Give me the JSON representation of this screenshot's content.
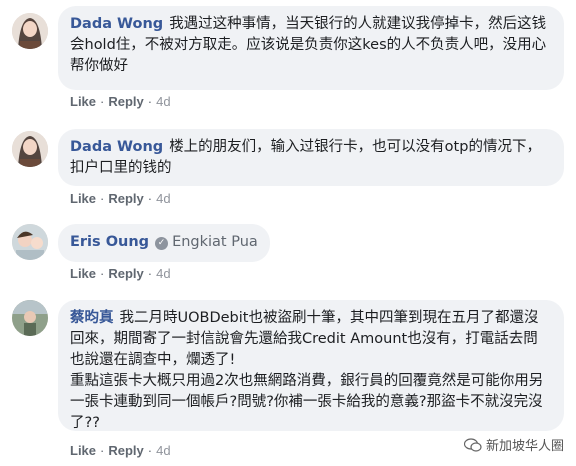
{
  "comments": [
    {
      "author": "Dada Wong",
      "text": "我遇过这种事情，当天银行的人就建议我停掉卡，然后这钱会hold住，不被对方取走。应该说是负责你这kes的人不负责人吧，没用心帮你做好",
      "like": "Like",
      "reply": "Reply",
      "time": "4d"
    },
    {
      "author": "Dada Wong",
      "text": "楼上的朋友们，输入过银行卡，也可以没有otp的情况下，扣户口里的钱的",
      "like": "Like",
      "reply": "Reply",
      "time": "4d"
    },
    {
      "author": "Eris Oung",
      "tagged": "Engkiat Pua",
      "like": "Like",
      "reply": "Reply",
      "time": "4d"
    },
    {
      "author": "蔡昀真",
      "text": "我二月時UOBDebit也被盜刷十筆，其中四筆到現在五月了都還沒回來，期間寄了一封信說會先還給我Credit Amount也沒有，打電話去問也說還在調查中，爛透了!",
      "text2": "重點這張卡大概只用過2次也無網路消費，銀行員的回覆竟然是可能你用另一張卡連動到同一個帳戶?問號?你補一張卡給我的意義?那盜卡不就沒完沒了??",
      "like": "Like",
      "reply": "Reply",
      "time": "4d"
    }
  ],
  "watermark": "新加坡华人圈",
  "colors": {
    "author": "#385898",
    "bubble": "#f0f2f5",
    "meta": "#606770"
  }
}
